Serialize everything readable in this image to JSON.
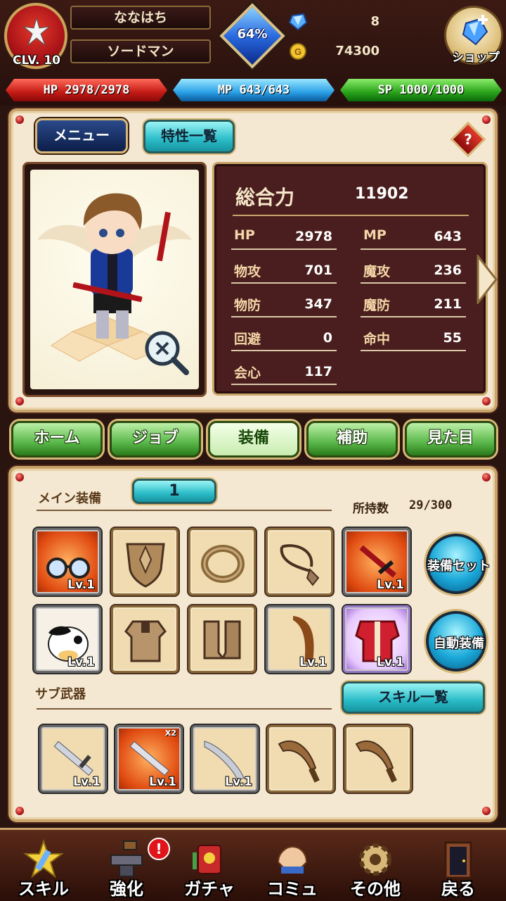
{
  "player": {
    "name": "ななはち",
    "job": "ソードマン",
    "class_level": "CLV. 10",
    "exp_percent": "64%"
  },
  "currency": {
    "crystals": "8",
    "gold": "74300"
  },
  "shop": {
    "label": "ショップ"
  },
  "bars": {
    "hp": "HP 2978/2978",
    "mp": "MP 643/643",
    "sp": "SP 1000/1000"
  },
  "status_panel": {
    "menu_button": "メニュー",
    "traits_button": "特性一覧",
    "help_button": "?",
    "total_label": "総合力",
    "total_value": "11902",
    "stats": [
      {
        "label": "HP",
        "value": "2978"
      },
      {
        "label": "MP",
        "value": "643"
      },
      {
        "label": "物攻",
        "value": "701"
      },
      {
        "label": "魔攻",
        "value": "236"
      },
      {
        "label": "物防",
        "value": "347"
      },
      {
        "label": "魔防",
        "value": "211"
      },
      {
        "label": "回避",
        "value": "0"
      },
      {
        "label": "命中",
        "value": "55"
      },
      {
        "label": "会心",
        "value": "117"
      }
    ]
  },
  "tabs": [
    {
      "label": "ホーム"
    },
    {
      "label": "ジョブ"
    },
    {
      "label": "装備"
    },
    {
      "label": "補助"
    },
    {
      "label": "見た目"
    }
  ],
  "equipment": {
    "main_title": "メイン装備",
    "page": "1",
    "owned_label": "所持数",
    "owned_value": "29/300",
    "equip_set_button": "装備セット",
    "auto_equip_button": "自動装備",
    "sub_title": "サブ武器",
    "skill_list_button": "スキル一覧",
    "row1": [
      {
        "item": "glasses-icon",
        "level": "Lv.1"
      },
      {
        "item": "shield-icon",
        "level": ""
      },
      {
        "item": "ring-icon",
        "level": ""
      },
      {
        "item": "necklace-icon",
        "level": ""
      },
      {
        "item": "sword-icon",
        "level": "Lv.1"
      }
    ],
    "row2": [
      {
        "item": "cow-icon",
        "level": "Lv.1"
      },
      {
        "item": "armor-icon",
        "level": ""
      },
      {
        "item": "boots-icon",
        "level": ""
      },
      {
        "item": "cloak-icon",
        "level": "Lv.1"
      },
      {
        "item": "red-armor-icon",
        "level": "Lv.1"
      }
    ],
    "sub": [
      {
        "item": "sword-icon",
        "level": "Lv.1",
        "count": ""
      },
      {
        "item": "sword-icon",
        "level": "Lv.1",
        "count": "X2"
      },
      {
        "item": "sword-icon",
        "level": "Lv.1",
        "count": ""
      },
      {
        "item": "machete-icon",
        "level": "",
        "count": ""
      },
      {
        "item": "machete-icon",
        "level": "",
        "count": ""
      }
    ]
  },
  "bottom_nav": [
    {
      "label": "スキル",
      "icon": "skill-icon"
    },
    {
      "label": "強化",
      "icon": "anvil-icon"
    },
    {
      "label": "ガチャ",
      "icon": "gacha-icon"
    },
    {
      "label": "コミュ",
      "icon": "community-icon"
    },
    {
      "label": "その他",
      "icon": "gear-icon"
    },
    {
      "label": "戻る",
      "icon": "door-icon"
    }
  ],
  "notice_badge": "!"
}
